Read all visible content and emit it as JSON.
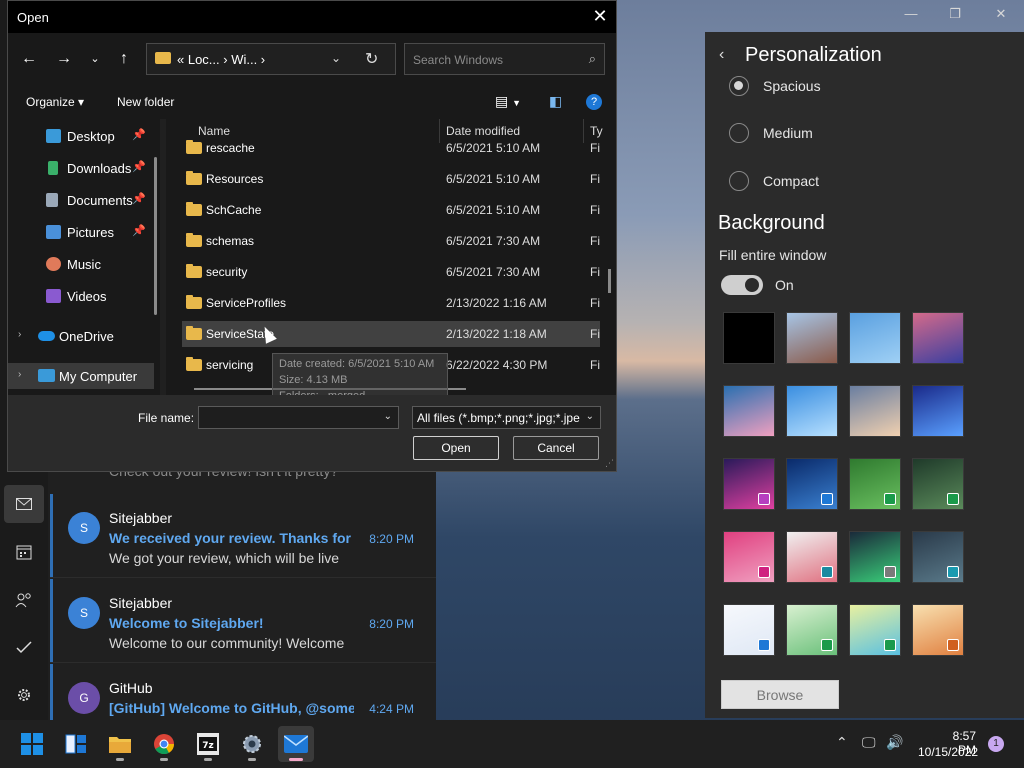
{
  "mail": {
    "top_preview": "Check out your review! Isn't it pretty?",
    "items": [
      {
        "avatar": "S",
        "sender": "Sitejabber",
        "subject": "We received your review. Thanks for",
        "time": "8:20 PM",
        "preview": "We got your review, which will be live",
        "avatar_color": "#3b82d6"
      },
      {
        "avatar": "S",
        "sender": "Sitejabber",
        "subject": "Welcome to Sitejabber!",
        "time": "8:20 PM",
        "preview": "Welcome to our community! Welcome",
        "avatar_color": "#3b82d6"
      },
      {
        "avatar": "G",
        "sender": "GitHub",
        "subject": "[GitHub] Welcome to GitHub, @some",
        "time": "4:24 PM",
        "preview": "",
        "avatar_color": "#6b4ea8"
      }
    ]
  },
  "settings": {
    "title": "Personalization",
    "spacing_options": [
      "Spacious",
      "Medium",
      "Compact"
    ],
    "selected_spacing": "Spacious",
    "background_heading": "Background",
    "fill_label": "Fill entire window",
    "fill_state": "On",
    "browse_label": "Browse",
    "tiles": [
      {
        "colors": [
          "#000000",
          "#000000"
        ],
        "badge": ""
      },
      {
        "colors": [
          "#a7c5e6",
          "#8a5a4a"
        ],
        "badge": ""
      },
      {
        "colors": [
          "#5aa0e0",
          "#9fd0f5"
        ],
        "badge": ""
      },
      {
        "colors": [
          "#d46a8a",
          "#3a3fa0"
        ],
        "badge": ""
      },
      {
        "colors": [
          "#2a6fb0",
          "#f0a0c0"
        ],
        "badge": ""
      },
      {
        "colors": [
          "#3a8ee0",
          "#b7e0ff"
        ],
        "badge": ""
      },
      {
        "colors": [
          "#6a7ea0",
          "#f0d0b0"
        ],
        "badge": ""
      },
      {
        "colors": [
          "#1a2a8a",
          "#5aa0ff"
        ],
        "badge": ""
      },
      {
        "colors": [
          "#2a1a5a",
          "#e040a0"
        ],
        "badge": "#b63fc0"
      },
      {
        "colors": [
          "#0a2a6a",
          "#3a80d0"
        ],
        "badge": "#1e78d6"
      },
      {
        "colors": [
          "#2f7a2f",
          "#6ac060"
        ],
        "badge": "#1a9a4a"
      },
      {
        "colors": [
          "#1f3a2a",
          "#5a8a5a"
        ],
        "badge": "#1a9a4a"
      },
      {
        "colors": [
          "#e04080",
          "#f0a0c0"
        ],
        "badge": "#d02080"
      },
      {
        "colors": [
          "#f0f0f0",
          "#e07080"
        ],
        "badge": "#1a8aa0"
      },
      {
        "colors": [
          "#1a2a3a",
          "#3ad07a"
        ],
        "badge": "#7a7a7a"
      },
      {
        "colors": [
          "#2a3a4a",
          "#5a7a8a"
        ],
        "badge": "#1a9ab0"
      },
      {
        "colors": [
          "#f6f8fc",
          "#dfe8f5"
        ],
        "badge": "#1e78d6"
      },
      {
        "colors": [
          "#d8f0d0",
          "#6ac07a"
        ],
        "badge": "#1a9a4a"
      },
      {
        "colors": [
          "#e8f0a0",
          "#5ac0e0"
        ],
        "badge": "#1a9a4a"
      },
      {
        "colors": [
          "#f8e0b0",
          "#e08040"
        ],
        "badge": "#d06020"
      }
    ]
  },
  "dialog": {
    "title": "Open",
    "breadcrumb": "« Loc... › Wi... ›",
    "search_placeholder": "Search Windows",
    "organize_label": "Organize ▾",
    "new_folder_label": "New folder",
    "columns": {
      "name": "Name",
      "date": "Date modified",
      "type": "Ty"
    },
    "nav_items": [
      {
        "label": "Desktop",
        "pinned": true,
        "color": "#3a9ad9"
      },
      {
        "label": "Downloads",
        "pinned": true,
        "color": "#3ab06a"
      },
      {
        "label": "Documents",
        "pinned": true,
        "color": "#9aa8b8"
      },
      {
        "label": "Pictures",
        "pinned": true,
        "color": "#4a90d9"
      },
      {
        "label": "Music",
        "pinned": false,
        "color": "#e07a5a"
      },
      {
        "label": "Videos",
        "pinned": false,
        "color": "#8a5ad0"
      }
    ],
    "onedrive_label": "OneDrive",
    "mycomputer_label": "My Computer",
    "files": [
      {
        "name": "rescache",
        "date": "6/5/2021 5:10 AM",
        "type": "Fi"
      },
      {
        "name": "Resources",
        "date": "6/5/2021 5:10 AM",
        "type": "Fi"
      },
      {
        "name": "SchCache",
        "date": "6/5/2021 5:10 AM",
        "type": "Fi"
      },
      {
        "name": "schemas",
        "date": "6/5/2021 7:30 AM",
        "type": "Fi"
      },
      {
        "name": "security",
        "date": "6/5/2021 7:30 AM",
        "type": "Fi"
      },
      {
        "name": "ServiceProfiles",
        "date": "2/13/2022 1:16 AM",
        "type": "Fi"
      },
      {
        "name": "ServiceState",
        "date": "2/13/2022 1:18 AM",
        "type": "Fi"
      },
      {
        "name": "servicing",
        "date": "6/22/2022 4:30 PM",
        "type": "Fi"
      }
    ],
    "hovered_file": "ServiceState",
    "tooltip": {
      "created": "Date created: 6/5/2021 5:10 AM",
      "size": "Size: 4.13 MB",
      "folders": "Folders: _merged"
    },
    "file_name_label": "File name:",
    "file_name_value": "",
    "filter_value": "All files (*.bmp;*.png;*.jpg;*.jpe",
    "open_label": "Open",
    "cancel_label": "Cancel"
  },
  "taskbar": {
    "time": "8:57 PM",
    "date": "10/15/2022",
    "notifications": "1"
  }
}
